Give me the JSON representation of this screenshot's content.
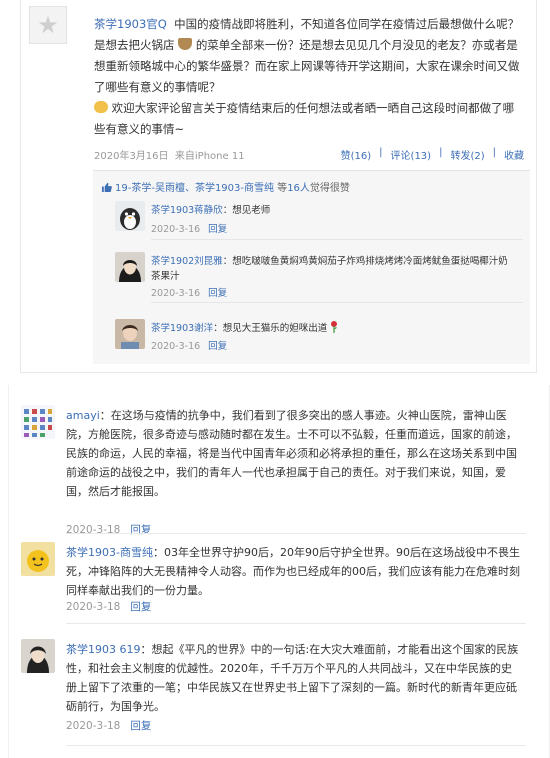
{
  "post": {
    "author": "茶学1903官Q",
    "text_part1": "中国的疫情战即将胜利，不知道各位同学在疫情过后最想做什么呢？是想去把火锅店",
    "text_part2": "的菜单全部来一份？还是想去见见几个月没见的老友？亦或者是想重新领略城中心的繁华盛景？而在家上网课等待开学这期间，大家在课余时间又做了哪些有意义的事情呢？",
    "text_part3": "欢迎大家评论留言关于疫情结束后的任何想法或者晒一晒自己这段时间都做了哪些有意义的事情~",
    "date": "2020年3月16日",
    "source": "来自iPhone 11",
    "actions": {
      "like": "赞(16)",
      "comment": "评论(13)",
      "repost": "转发(2)",
      "collect": "收藏"
    },
    "likes_line": {
      "names": "19-茶学-吴雨檀、茶学1903-商雪纯",
      "suffix_pre": " 等",
      "count": "16人",
      "suffix_post": "觉得很赞"
    }
  },
  "sub_comments": [
    {
      "author": "茶学1903蒋静欣",
      "text": "：想见老师",
      "date": "2020-3-16",
      "reply": "回复"
    },
    {
      "author": "茶学1902刘昆雅",
      "text": "：想吃啵啵鱼黄焖鸡黄焖茄子炸鸡排烧烤烤冷面烤鱿鱼蛋挞喝椰汁奶茶果汁",
      "date": "2020-3-16",
      "reply": "回复"
    },
    {
      "author": "茶学1903谢洋",
      "text": "：想见大王猫乐的妲咪出道",
      "date": "2020-3-16",
      "reply": "回复"
    }
  ],
  "comments": [
    {
      "author": "amayi",
      "text": "：在这场与疫情的抗争中，我们看到了很多突出的感人事迹。火神山医院，雷神山医院，方舱医院，很多奇迹与感动随时都在发生。士不可以不弘毅，任重而道远，国家的前途，民族的命运，人民的幸福，将是当代中国青年必须和必将承担的重任，那么在这场关系到中国前途命运的战役之中，我们的青年人一代也承担属于自己的责任。对于我们来说，知国，爱国，然后才能报国。",
      "date": "2020-3-18",
      "reply": "回复"
    },
    {
      "author": "茶学1903-商雪纯",
      "text": "：03年全世界守护90后，20年90后守护全世界。90后在这场战役中不畏生死，冲锋陷阵的大无畏精神令人动容。而作为也已经成年的00后，我们应该有能力在危难时刻同样奉献出我们的一份力量。",
      "date": "2020-3-18",
      "reply": "回复"
    },
    {
      "author": "茶学1903 619",
      "text": "：想起《平凡的世界》中的一句话:在大灾大难面前，才能看出这个国家的民族性，和社会主义制度的优越性。2020年，千千万万个平凡的人共同战斗，又在中华民族的史册上留下了浓重的一笔；中华民族又在世界史书上留下了深刻的一篇。新时代的新青年更应砥砺前行，为国争光。",
      "date": "2020-3-18",
      "reply": "回复"
    }
  ]
}
